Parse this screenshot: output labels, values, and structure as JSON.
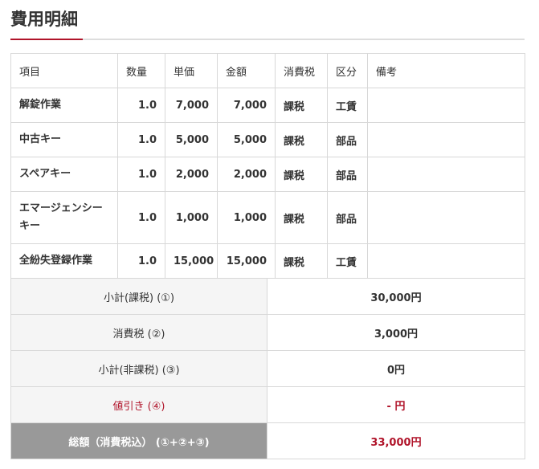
{
  "title": "費用明細",
  "headers": [
    "項目",
    "数量",
    "単価",
    "金額",
    "消費税",
    "区分",
    "備考"
  ],
  "rows": [
    {
      "item": "解錠作業",
      "qty": "1.0",
      "unit_price": "7,000",
      "amount": "7,000",
      "tax": "課税",
      "category": "工賃",
      "note": ""
    },
    {
      "item": "中古キー",
      "qty": "1.0",
      "unit_price": "5,000",
      "amount": "5,000",
      "tax": "課税",
      "category": "部品",
      "note": ""
    },
    {
      "item": "スペアキー",
      "qty": "1.0",
      "unit_price": "2,000",
      "amount": "2,000",
      "tax": "課税",
      "category": "部品",
      "note": ""
    },
    {
      "item": "エマージェンシーキー",
      "qty": "1.0",
      "unit_price": "1,000",
      "amount": "1,000",
      "tax": "課税",
      "category": "部品",
      "note": ""
    },
    {
      "item": "全紛失登録作業",
      "qty": "1.0",
      "unit_price": "15,000",
      "amount": "15,000",
      "tax": "課税",
      "category": "工賃",
      "note": ""
    }
  ],
  "summary": {
    "subtotal_taxable": {
      "label": "小計(課税) (①)",
      "value": "30,000円"
    },
    "consumption_tax": {
      "label": "消費税 (②)",
      "value": "3,000円"
    },
    "subtotal_nontaxable": {
      "label": "小計(非課税) (③)",
      "value": "0円"
    },
    "discount": {
      "label": "値引き (④)",
      "value": "- 円"
    },
    "total": {
      "label": "総額（消費税込） (①+②+③)",
      "value": "33,000円"
    }
  },
  "colors": {
    "accent": "#b0142a",
    "total_label_bg": "#999999",
    "label_bg": "#f5f5f5",
    "border": "#d8d8d8"
  }
}
